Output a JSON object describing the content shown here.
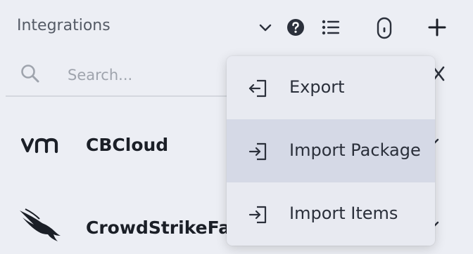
{
  "header": {
    "title": "Integrations",
    "icons": [
      "chevron-down-icon",
      "help-icon",
      "list-icon",
      "mouse-icon",
      "plus-icon"
    ]
  },
  "search": {
    "placeholder": "Search...",
    "value": ""
  },
  "integrations": [
    {
      "logo": "vm",
      "name": "CBCloud"
    },
    {
      "logo": "falcon-icon",
      "name": "CrowdStrikeFa"
    }
  ],
  "menu": {
    "items": [
      {
        "label": "Export",
        "icon": "export-icon"
      },
      {
        "label": "Import Package",
        "icon": "import-icon"
      },
      {
        "label": "Import Items",
        "icon": "import-icon"
      }
    ]
  },
  "colors": {
    "background": "#eceef4",
    "menu": "#e8eaf1",
    "menu_active": "#d5d9e6"
  }
}
